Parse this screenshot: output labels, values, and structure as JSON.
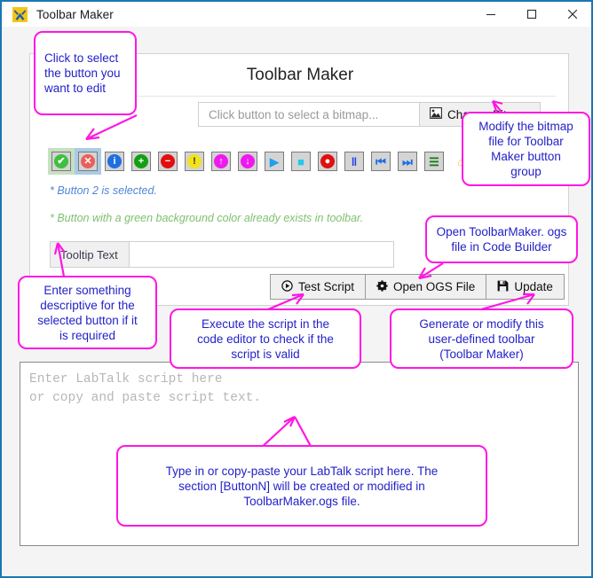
{
  "window": {
    "title": "Toolbar Maker",
    "app_icon": "toolbar-maker-icon",
    "minimize_label": "─",
    "maximize_label": "□",
    "close_label": "✕",
    "accent_border": "#1b76b5"
  },
  "panel": {
    "title": "Toolbar Maker",
    "bitmap": {
      "placeholder": "Click button to select a bitmap...",
      "value": "",
      "change_button_label": "Change Bitmap",
      "change_button_icon": "image-icon"
    },
    "messages": {
      "selected": "* Button 2 is selected.",
      "selected_color": "#4f86d6",
      "exists": "* Button with a green background color already exists in toolbar.",
      "exists_color": "#7fbf6f"
    },
    "tooltip": {
      "label": "Tooltip Text",
      "value": "",
      "placeholder": ""
    },
    "buttons": [
      {
        "index": 1,
        "name": "check-circle-icon",
        "glyph": "✔",
        "color": "#3ec03e",
        "state": "exists",
        "boxed": true
      },
      {
        "index": 2,
        "name": "cancel-circle-icon",
        "glyph": "✕",
        "color": "#e8605a",
        "state": "selected",
        "boxed": true
      },
      {
        "index": 3,
        "name": "info-circle-icon",
        "glyph": "i",
        "color": "#1f6fe0",
        "state": "normal",
        "boxed": true
      },
      {
        "index": 4,
        "name": "add-circle-icon",
        "glyph": "+",
        "color": "#12a012",
        "state": "normal",
        "boxed": true
      },
      {
        "index": 5,
        "name": "remove-circle-icon",
        "glyph": "−",
        "color": "#e01010",
        "state": "normal",
        "boxed": true
      },
      {
        "index": 6,
        "name": "warning-circle-icon",
        "glyph": "!",
        "color": "#f2e21a",
        "state": "normal",
        "boxed": true
      },
      {
        "index": 7,
        "name": "arrow-up-circle-icon",
        "glyph": "↑",
        "color": "#ee19ee",
        "state": "normal",
        "boxed": true
      },
      {
        "index": 8,
        "name": "arrow-down-circle-icon",
        "glyph": "↓",
        "color": "#ee19ee",
        "state": "normal",
        "boxed": true
      },
      {
        "index": 9,
        "name": "play-icon",
        "glyph": "▶",
        "color": "#1f9ff0",
        "state": "normal",
        "boxed": true
      },
      {
        "index": 10,
        "name": "stop-icon",
        "glyph": "■",
        "color": "#22c8ee",
        "state": "normal",
        "boxed": true
      },
      {
        "index": 11,
        "name": "record-icon",
        "glyph": "●",
        "color": "#e01010",
        "state": "normal",
        "boxed": true
      },
      {
        "index": 12,
        "name": "pause-icon",
        "glyph": "‖",
        "color": "#1f3fe0",
        "state": "normal",
        "boxed": true
      },
      {
        "index": 13,
        "name": "skip-previous-icon",
        "glyph": "⏮",
        "color": "#1f6fe0",
        "state": "normal",
        "boxed": true
      },
      {
        "index": 14,
        "name": "skip-next-icon",
        "glyph": "⏭",
        "color": "#1f6fe0",
        "state": "normal",
        "boxed": true
      },
      {
        "index": 15,
        "name": "signal-peaks-icon",
        "glyph": "☰",
        "color": "#107a10",
        "state": "normal",
        "boxed": true
      },
      {
        "index": 16,
        "name": "home-icon",
        "glyph": "⌂",
        "color": "#f2cf1a",
        "state": "normal",
        "boxed": false
      }
    ],
    "actions": [
      {
        "name": "test-script-button",
        "label": "Test Script",
        "icon": "play-circle-icon"
      },
      {
        "name": "open-ogs-button",
        "label": "Open OGS File",
        "icon": "gear-icon"
      },
      {
        "name": "update-button",
        "label": "Update",
        "icon": "save-icon"
      }
    ]
  },
  "script_editor": {
    "placeholder": "Enter LabTalk script here\nor copy and paste script text.",
    "value": ""
  },
  "annotations": {
    "color": "#ff16e4",
    "text_color": "#2222c8",
    "items": [
      {
        "name": "annotation-select-button",
        "text": "Click to select\nthe button you\nwant to edit"
      },
      {
        "name": "annotation-change-bitmap",
        "text": "Modify the bitmap\nfile for Toolbar\nMaker button\ngroup"
      },
      {
        "name": "annotation-open-ogs",
        "text": "Open  ToolbarMaker. ogs\nfile in Code Builder"
      },
      {
        "name": "annotation-tooltip",
        "text": "Enter something\ndescriptive for the\nselected button if it\nis required"
      },
      {
        "name": "annotation-test-script",
        "text": "Execute the script in the\ncode editor to check if the\nscript is valid"
      },
      {
        "name": "annotation-update",
        "text": "Generate or modify this\nuser-defined toolbar\n(Toolbar Maker)"
      },
      {
        "name": "annotation-script-editor",
        "text": "Type in or copy-paste your LabTalk script here. The\nsection [ButtonN] will be created or modified in\nToolbarMaker.ogs file."
      }
    ]
  }
}
